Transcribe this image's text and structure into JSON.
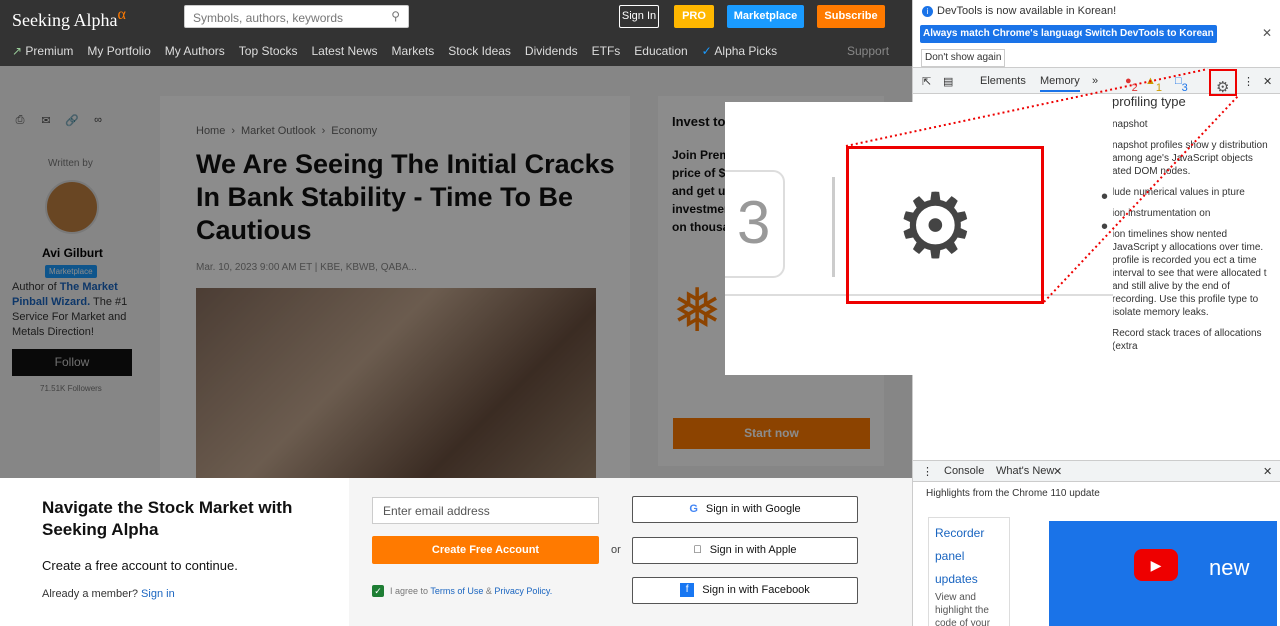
{
  "header": {
    "logo": "Seeking Alpha",
    "logo_mark": "α",
    "search_placeholder": "Symbols, authors, keywords",
    "signin": "Sign In",
    "pro": "PRO",
    "marketplace": "Marketplace",
    "subscribe": "Subscribe",
    "nav": [
      "Premium",
      "My Portfolio",
      "My Authors",
      "Top Stocks",
      "Latest News",
      "Markets",
      "Stock Ideas",
      "Dividends",
      "ETFs",
      "Education",
      "Alpha Picks"
    ],
    "support": "Support"
  },
  "author": {
    "written_by": "Written by",
    "name": "Avi Gilburt",
    "badge": "Marketplace",
    "bio_prefix": "Author of ",
    "bio_link": "The Market Pinball Wizard.",
    "bio_suffix": " The #1 Service For Market and Metals Direction!",
    "follow": "Follow",
    "followers": "71.51K Followers"
  },
  "article": {
    "breadcrumb": [
      "Home",
      "Market Outlook",
      "Economy"
    ],
    "title": "We Are Seeing The Initial Cracks In Bank Stability - Time To Be Cautious",
    "meta": "Mar. 10, 2023 9:00 AM ET | KBE, KBWB, QABA..."
  },
  "sidebar_promo": {
    "heading": "Invest to",
    "lines": [
      "Join Prem",
      "price of $",
      "and get u",
      "investmen",
      "on thousa"
    ],
    "cta": "Start now"
  },
  "signup": {
    "title": "Navigate the Stock Market with Seeking Alpha",
    "subtitle": "Create a free account to continue.",
    "member_text": "Already a member? ",
    "member_link": "Sign in",
    "email_placeholder": "Enter email address",
    "create_button": "Create Free Account",
    "or": "or",
    "agree_prefix": "I agree to ",
    "terms": "Terms of Use",
    "and": " & ",
    "privacy": "Privacy Policy.",
    "google": "Sign in with Google",
    "apple": "Sign in with Apple",
    "facebook": "Sign in with Facebook"
  },
  "devtools": {
    "notice": "DevTools is now available in Korean!",
    "btn_match": "Always match Chrome's language",
    "btn_switch": "Switch DevTools to Korean",
    "dont_show": "Don't show again",
    "tabs": [
      "Elements",
      "Memory"
    ],
    "errors": "2",
    "warnings": "1",
    "messages": "3",
    "memory_heading": "profiling type",
    "memory_p1": "napshot",
    "memory_p2": "napshot profiles show y distribution among age's JavaScript objects ated DOM nodes.",
    "memory_p3": "lude numerical values in pture",
    "memory_p4": "ion instrumentation on",
    "memory_p5": "ion timelines show nented JavaScript y allocations over time. profile is recorded you ect a time interval to see that were allocated t and still alive by the end of recording. Use this profile type to isolate memory leaks.",
    "memory_p6": "Record stack traces of allocations (extra",
    "drawer_tabs": [
      "Console",
      "What's New"
    ],
    "highlights": "Highlights from the Chrome 110 update",
    "recorder": "Recorder panel updates",
    "recorder_sub": "View and highlight the code of your",
    "video_text": "new",
    "zoom_number": "3"
  }
}
